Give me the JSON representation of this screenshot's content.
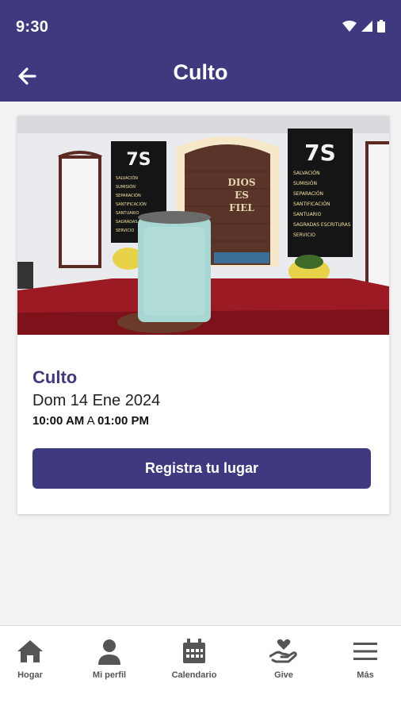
{
  "status_bar": {
    "time": "9:30"
  },
  "app_bar": {
    "title": "Culto"
  },
  "event": {
    "title": "Culto",
    "date": "Dom 14 Ene 2024",
    "start_time": "10:00 AM",
    "time_separator": " A ",
    "end_time": "01:00 PM",
    "cta_label": "Registra tu lugar"
  },
  "photo": {
    "banner_heading": "7S",
    "banner_lines": [
      "SALVACIÓN",
      "SUMISIÓN",
      "SEPARACIÓN",
      "SANTIFICACIÓN",
      "SANTUARIO",
      "SAGRADAS ESCRITURAS",
      "SERVICIO"
    ],
    "wall_sign_line1": "DIOS",
    "wall_sign_line2": "ES",
    "wall_sign_line3": "FIEL"
  },
  "bottom_nav": {
    "items": [
      {
        "label": "Hogar",
        "icon": "home-icon"
      },
      {
        "label": "Mi perfil",
        "icon": "person-icon"
      },
      {
        "label": "Calendario",
        "icon": "calendar-icon"
      },
      {
        "label": "Give",
        "icon": "give-heart-hand-icon"
      },
      {
        "label": "Más",
        "icon": "menu-icon"
      }
    ]
  },
  "colors": {
    "primary": "#3f3a80",
    "background": "#f2f2f2",
    "card": "#ffffff"
  }
}
